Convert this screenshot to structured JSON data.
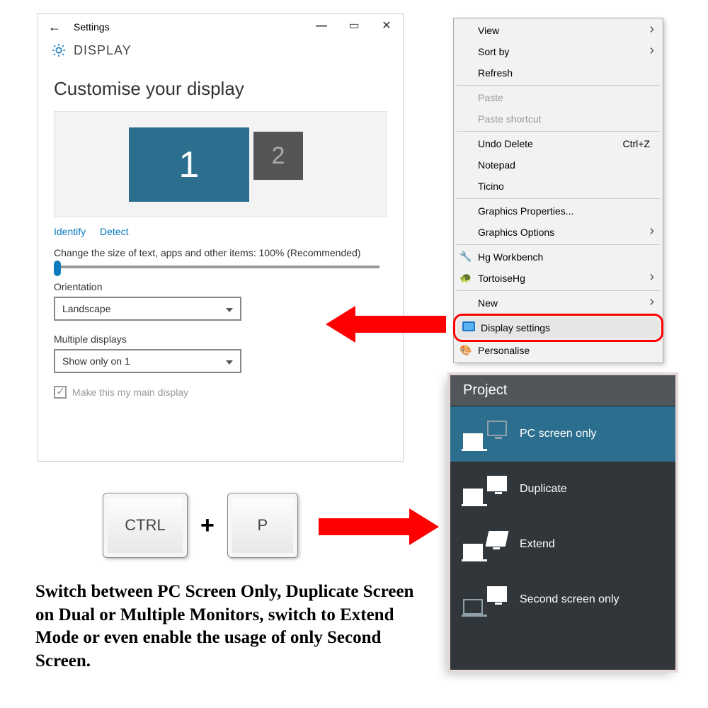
{
  "settings": {
    "titlebar": "Settings",
    "header": "DISPLAY",
    "customise_heading": "Customise your display",
    "monitors": {
      "primary_label": "1",
      "secondary_label": "2"
    },
    "identify": "Identify",
    "detect": "Detect",
    "scale_label": "Change the size of text, apps and other items: 100% (Recommended)",
    "orientation_label": "Orientation",
    "orientation_value": "Landscape",
    "multi_label": "Multiple displays",
    "multi_value": "Show only on 1",
    "main_display": "Make this my main display"
  },
  "contextmenu": {
    "view": "View",
    "sortby": "Sort by",
    "refresh": "Refresh",
    "paste": "Paste",
    "paste_shortcut": "Paste shortcut",
    "undo": "Undo Delete",
    "undo_key": "Ctrl+Z",
    "notepad": "Notepad",
    "ticino": "Ticino",
    "gfxprops": "Graphics Properties...",
    "gfxopts": "Graphics Options",
    "hg": "Hg Workbench",
    "tortoise": "TortoiseHg",
    "new": "New",
    "display": "Display settings",
    "personalise": "Personalise"
  },
  "keys": {
    "ctrl": "CTRL",
    "p": "P"
  },
  "project": {
    "title": "Project",
    "pc_only": "PC screen only",
    "duplicate": "Duplicate",
    "extend": "Extend",
    "second_only": "Second screen only"
  },
  "caption": "Switch between PC Screen Only, Duplicate Screen on Dual or Multiple Monitors, switch to Extend Mode or even enable the usage of only Second Screen."
}
